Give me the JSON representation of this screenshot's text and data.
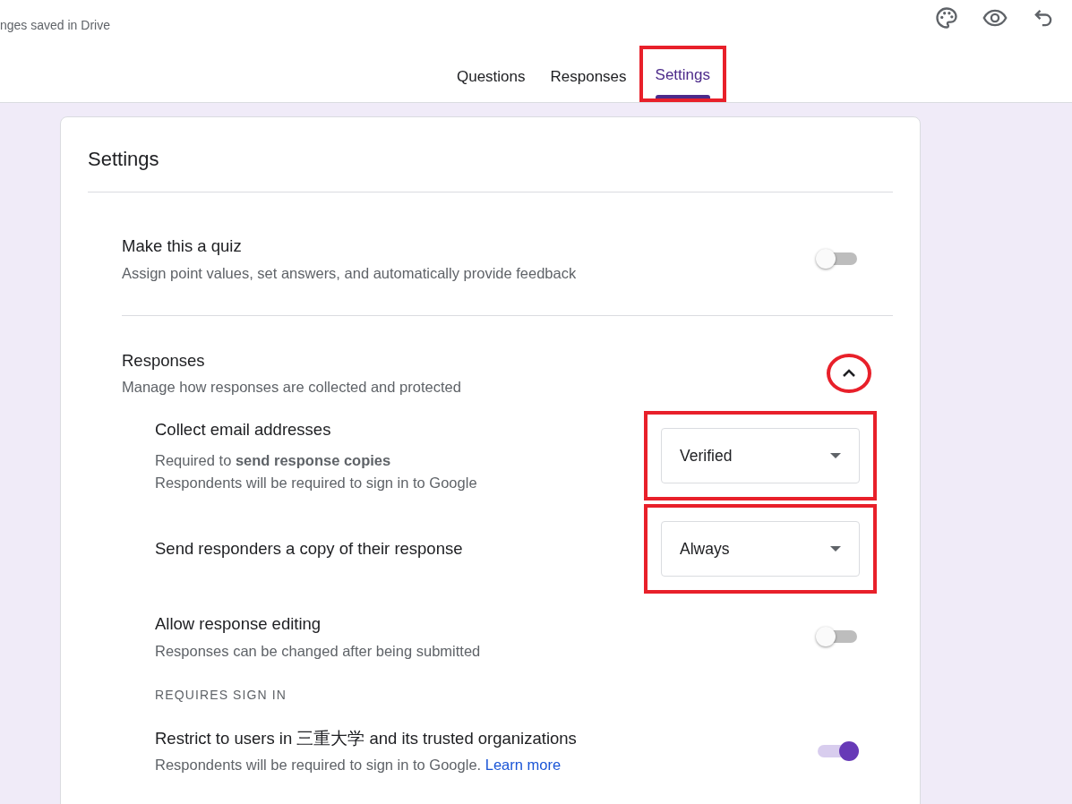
{
  "header": {
    "status": "nges saved in Drive"
  },
  "tabs": [
    {
      "label": "Questions",
      "selected": false,
      "highlighted": false
    },
    {
      "label": "Responses",
      "selected": false,
      "highlighted": false
    },
    {
      "label": "Settings",
      "selected": true,
      "highlighted": true
    }
  ],
  "card": {
    "title": "Settings",
    "sections": [
      {
        "kind": "toggle",
        "title": "Make this a quiz",
        "description": "Assign point values, set answers, and automatically provide feedback",
        "on": false
      },
      {
        "kind": "expandable",
        "title": "Responses",
        "description": "Manage how responses are collected and protected",
        "expanded": true,
        "highlighted": true,
        "items": [
          {
            "kind": "dropdown",
            "title": "Collect email addresses",
            "description_lines": [
              "Required to **send response copies**",
              "Respondents will be required to sign in to Google"
            ],
            "value": "Verified",
            "highlighted": true
          },
          {
            "kind": "dropdown",
            "title": "Send responders a copy of their response",
            "value": "Always",
            "highlighted": true
          },
          {
            "kind": "toggle",
            "title": "Allow response editing",
            "description": "Responses can be changed after being submitted",
            "on": false
          },
          {
            "kind": "heading",
            "text": "REQUIRES SIGN IN"
          },
          {
            "kind": "toggle",
            "title": "Restrict to users in 三重大学 and its trusted organizations",
            "description": "Respondents will be required to sign in to Google.",
            "link": "Learn more",
            "on": true
          }
        ]
      }
    ]
  }
}
